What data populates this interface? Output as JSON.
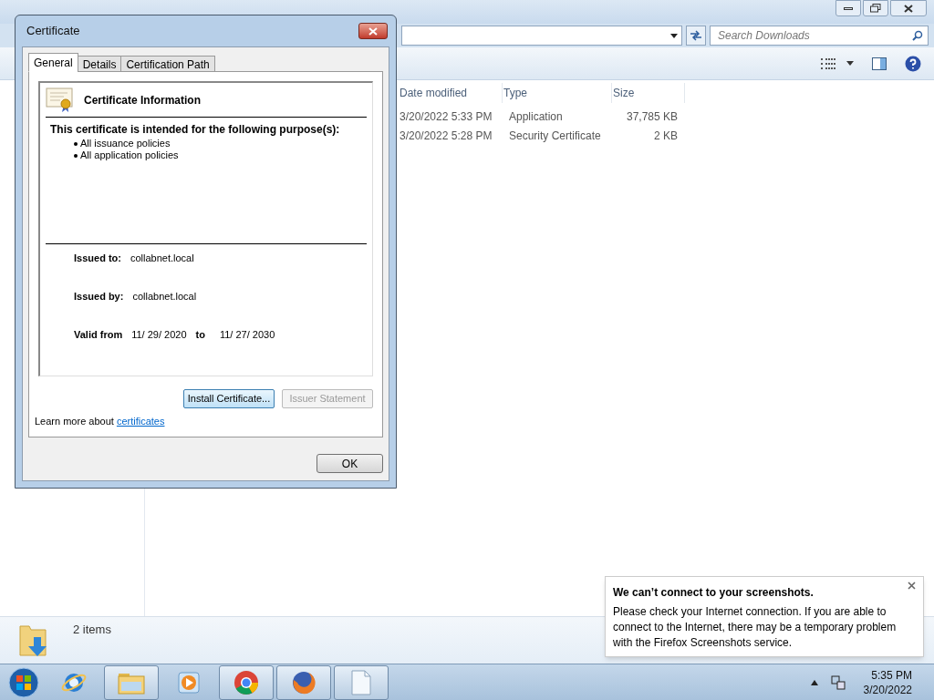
{
  "explorer": {
    "search_placeholder": "Search Downloads",
    "columns": [
      "Date modified",
      "Type",
      "Size"
    ],
    "rows": [
      {
        "date_modified": "3/20/2022 5:33 PM",
        "type": "Application",
        "size": "37,785 KB"
      },
      {
        "date_modified": "3/20/2022 5:28 PM",
        "type": "Security Certificate",
        "size": "2 KB"
      }
    ],
    "status": "2 items"
  },
  "dialog": {
    "title": "Certificate",
    "tabs": [
      {
        "label": "General",
        "selected": true
      },
      {
        "label": "Details",
        "selected": false
      },
      {
        "label": "Certification Path",
        "selected": false
      }
    ],
    "heading": "Certificate Information",
    "purpose_title": "This certificate is intended for the following purpose(s):",
    "purposes": [
      "All issuance policies",
      "All application policies"
    ],
    "issued_to": {
      "label": "Issued to:",
      "value": "collabnet.local"
    },
    "issued_by": {
      "label": "Issued by:",
      "value": "collabnet.local"
    },
    "valid": {
      "label": "Valid from",
      "from": "11/ 29/ 2020",
      "to_label": "to",
      "to": "11/ 27/ 2030"
    },
    "buttons": [
      {
        "label": "Install Certificate...",
        "disabled": false
      },
      {
        "label": "Issuer Statement",
        "disabled": true
      }
    ],
    "learn_more": {
      "text": "Learn more about",
      "link": "certificates"
    },
    "ok": "OK"
  },
  "toast": {
    "title": "We can’t connect to your screenshots.",
    "body": "Please check your Internet connection. If you are able to connect to the Internet, there may be a temporary problem with the Firefox Screenshots service."
  },
  "taskbar": {
    "apps": [
      {
        "kind": "ie",
        "running": false
      },
      {
        "kind": "folder",
        "running": true
      },
      {
        "kind": "media",
        "running": false
      },
      {
        "kind": "chrome",
        "running": true
      },
      {
        "kind": "firefox",
        "running": true
      },
      {
        "kind": "document",
        "running": true
      }
    ],
    "time": "5:35 PM",
    "date": "3/20/2022"
  }
}
